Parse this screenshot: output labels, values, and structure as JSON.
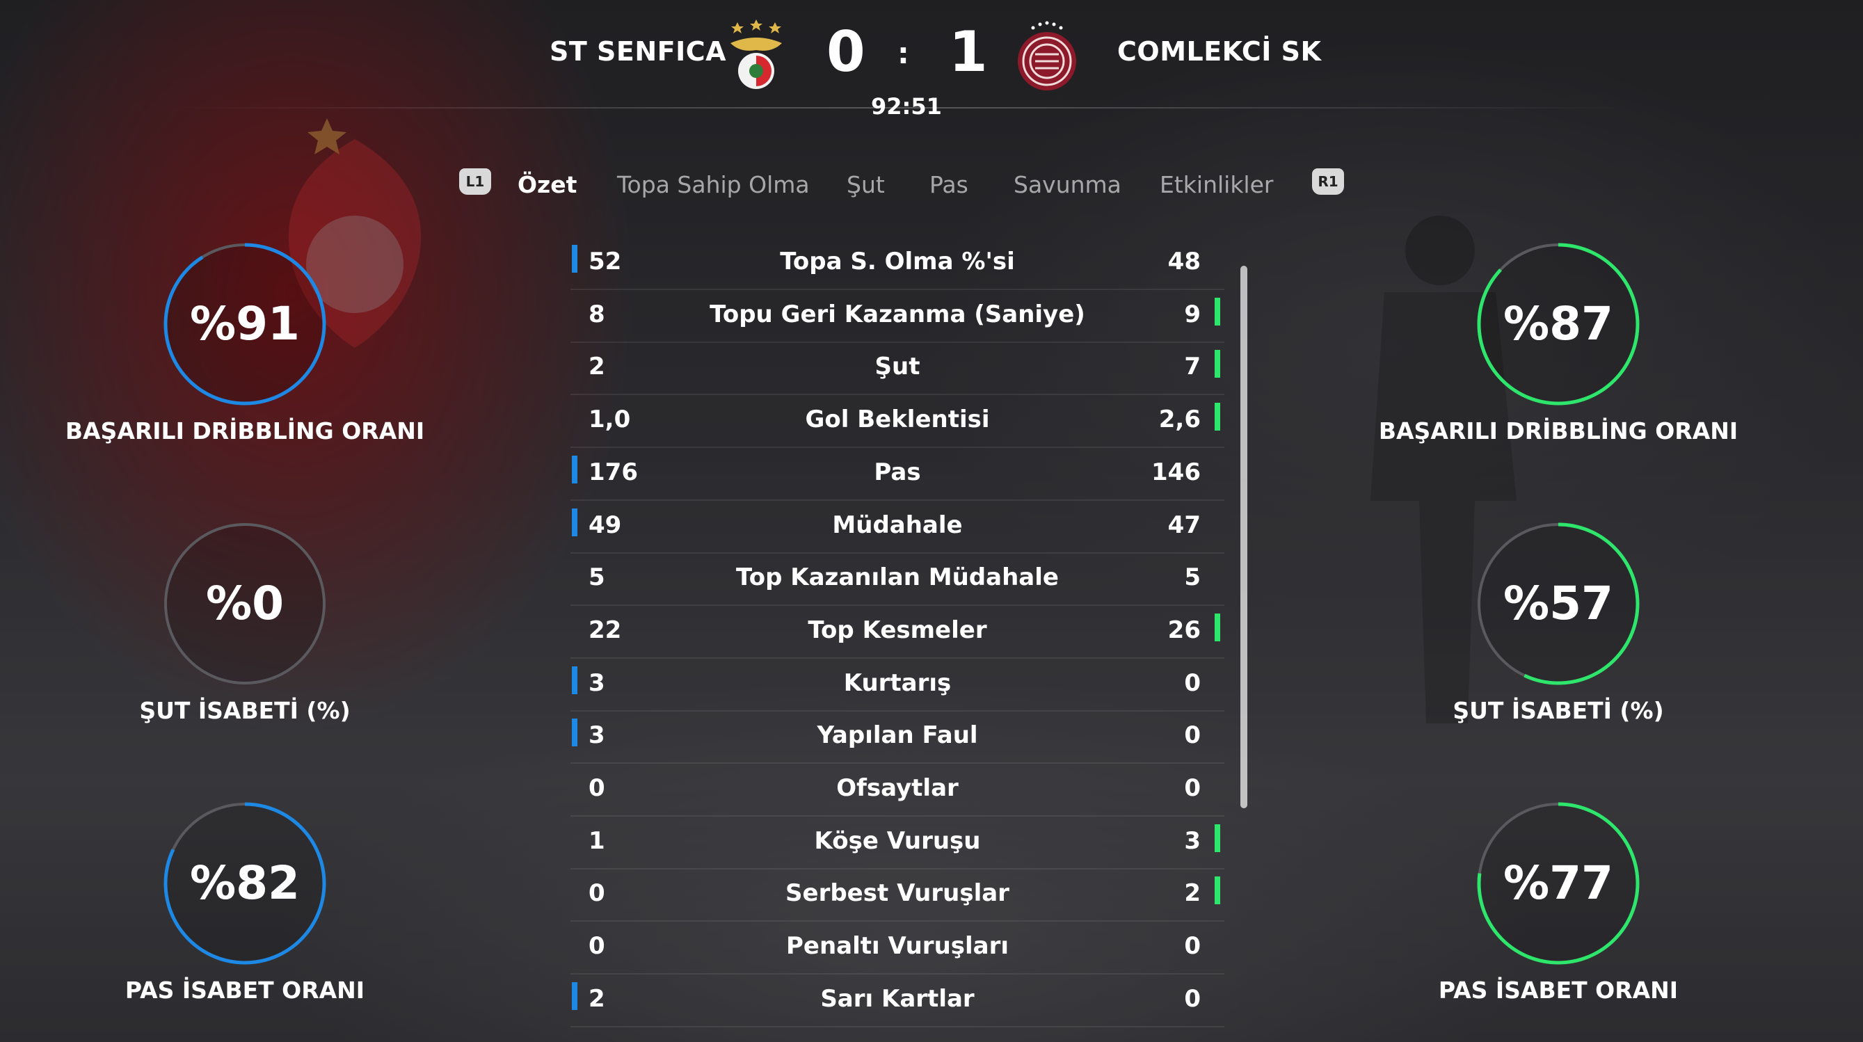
{
  "match": {
    "home_team": "ST SENFICA",
    "away_team": "COMLEKCİ SK",
    "home_score": "0",
    "separator": ":",
    "away_score": "1",
    "clock": "92:51"
  },
  "tabs": {
    "left_shoulder": "L1",
    "right_shoulder": "R1",
    "items": [
      "Özet",
      "Topa Sahip Olma",
      "Şut",
      "Pas",
      "Savunma",
      "Etkinlikler"
    ],
    "active": "Özet"
  },
  "stats": [
    {
      "label": "Topa S. Olma %'si",
      "home": "52",
      "away": "48",
      "leader": "home"
    },
    {
      "label": "Topu Geri Kazanma (Saniye)",
      "home": "8",
      "away": "9",
      "leader": "away"
    },
    {
      "label": "Şut",
      "home": "2",
      "away": "7",
      "leader": "away"
    },
    {
      "label": "Gol Beklentisi",
      "home": "1,0",
      "away": "2,6",
      "leader": "away"
    },
    {
      "label": "Pas",
      "home": "176",
      "away": "146",
      "leader": "home"
    },
    {
      "label": "Müdahale",
      "home": "49",
      "away": "47",
      "leader": "home"
    },
    {
      "label": "Top Kazanılan Müdahale",
      "home": "5",
      "away": "5",
      "leader": "none"
    },
    {
      "label": "Top Kesmeler",
      "home": "22",
      "away": "26",
      "leader": "away"
    },
    {
      "label": "Kurtarış",
      "home": "3",
      "away": "0",
      "leader": "home"
    },
    {
      "label": "Yapılan Faul",
      "home": "3",
      "away": "0",
      "leader": "home"
    },
    {
      "label": "Ofsaytlar",
      "home": "0",
      "away": "0",
      "leader": "none"
    },
    {
      "label": "Köşe Vuruşu",
      "home": "1",
      "away": "3",
      "leader": "away"
    },
    {
      "label": "Serbest Vuruşlar",
      "home": "0",
      "away": "2",
      "leader": "away"
    },
    {
      "label": "Penaltı Vuruşları",
      "home": "0",
      "away": "0",
      "leader": "none"
    },
    {
      "label": "Sarı Kartlar",
      "home": "2",
      "away": "0",
      "leader": "home"
    }
  ],
  "rings": {
    "home": [
      {
        "value": "%91",
        "fraction": 0.91,
        "label": "BAŞARILI DRİBBLİNG ORANI"
      },
      {
        "value": "%0",
        "fraction": 0.0,
        "label": "ŞUT İSABETİ (%)"
      },
      {
        "value": "%82",
        "fraction": 0.82,
        "label": "PAS İSABET ORANI"
      }
    ],
    "away": [
      {
        "value": "%87",
        "fraction": 0.87,
        "label": "BAŞARILI DRİBBLİNG ORANI"
      },
      {
        "value": "%57",
        "fraction": 0.57,
        "label": "ŞUT İSABETİ (%)"
      },
      {
        "value": "%77",
        "fraction": 0.77,
        "label": "PAS İSABET ORANI"
      }
    ]
  },
  "colors": {
    "home_accent": "#1e88e5",
    "away_accent": "#2ee66b",
    "ring_track": "#5a5a5e"
  },
  "icons": {
    "home_crest": "eagle-crest-icon",
    "away_crest": "round-monogram-crest-icon"
  }
}
